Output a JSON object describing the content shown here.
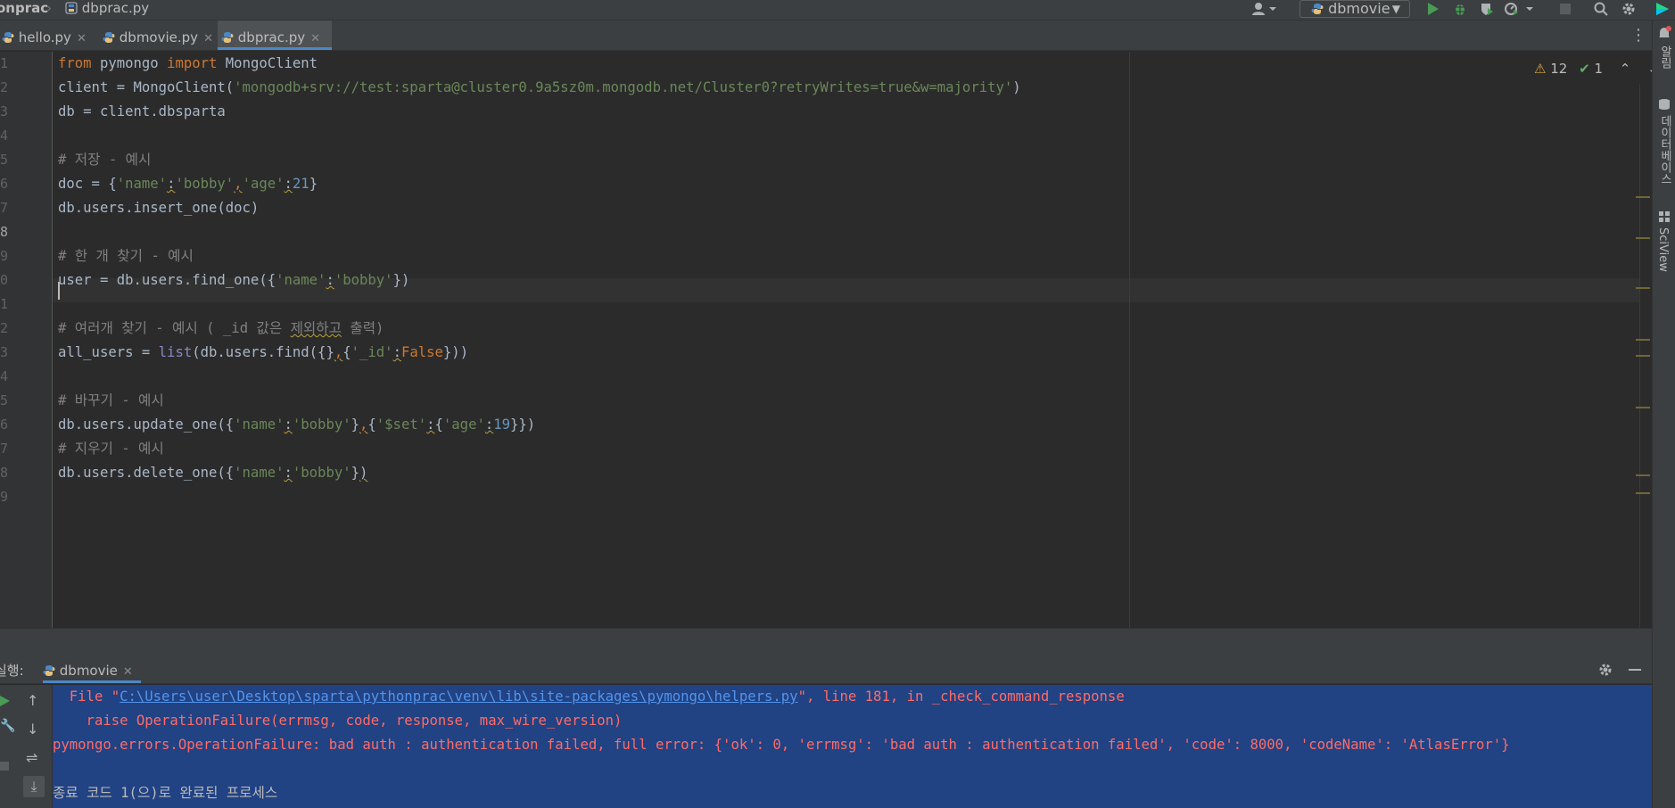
{
  "navbar": {
    "project": "onprac",
    "file": "dbprac.py",
    "run_config": "dbmovie"
  },
  "tabs": [
    {
      "label": "hello.py",
      "active": false
    },
    {
      "label": "dbmovie.py",
      "active": false
    },
    {
      "label": "dbprac.py",
      "active": true
    }
  ],
  "inspections": {
    "warnings": "12",
    "ok": "1"
  },
  "gutter": {
    "lines": [
      "1",
      "2",
      "3",
      "4",
      "5",
      "6",
      "7",
      "8",
      "9",
      "0",
      "1",
      "2",
      "3",
      "4",
      "5",
      "6",
      "7",
      "8",
      "9"
    ],
    "current_index": 7
  },
  "code": {
    "l1": {
      "a": "from",
      "b": " pymongo ",
      "c": "import",
      "d": " MongoClient"
    },
    "l2": {
      "a": "client = MongoClient(",
      "b": "'mongodb+srv://test:sparta@cluster0.9a5sz0m.mongodb.net/Cluster0?retryWrites=true&w=majority'",
      "c": ")"
    },
    "l3": "db = client.dbsparta",
    "l5": "# 저장 - 예시",
    "l6": {
      "a": "doc = {",
      "b": "'name'",
      "c": ":",
      "d": "'bobby'",
      "e": ",",
      "f": "'age'",
      "g": ":",
      "h": "21",
      "i": "}"
    },
    "l7": "db.users.insert_one(doc)",
    "l9": "# 한 개 찾기 - 예시",
    "l10": {
      "a": "user = db.users.find_one({",
      "b": "'name'",
      "c": ":",
      "d": "'bobby'",
      "e": "})"
    },
    "l12": {
      "a": "# 여러개 찾기 - 예시 ( _id 값은 ",
      "b": "제외하고",
      "c": " 출력)"
    },
    "l13": {
      "a": "all_users = ",
      "b": "list",
      "c": "(db.users.find({}",
      "d": ",",
      "e": "{",
      "f": "'_id'",
      "g": ":",
      "h": "False",
      "i": "}))"
    },
    "l15": "# 바꾸기 - 예시",
    "l16": {
      "a": "db.users.update_one({",
      "b": "'name'",
      "c": ":",
      "d": "'bobby'",
      "e": "}",
      "f": ",",
      "g": "{",
      "h": "'$set'",
      "i": ":",
      "j": "{",
      "k": "'age'",
      "l": ":",
      "m": "19",
      "n": "}})"
    },
    "l18": "# 지우기 - 예시",
    "l19": {
      "a": "db.users.delete_one({",
      "b": "'name'",
      "c": ":",
      "d": "'bobby'",
      "e": "}",
      "f": ")"
    }
  },
  "side_panels": {
    "database": "데이터베이스",
    "sciview": "SciView",
    "notifications": "알림"
  },
  "run_panel": {
    "label": "실행:",
    "tab": "dbmovie"
  },
  "console": {
    "line1": {
      "a": "  File \"",
      "link": "C:\\Users\\user\\Desktop\\sparta\\pythonprac\\venv\\lib\\site-packages\\pymongo\\helpers.py",
      "b": "\", line 181, in _check_command_response"
    },
    "line2": "    raise OperationFailure(errmsg, code, response, max_wire_version)",
    "line3": "pymongo.errors.OperationFailure: bad auth : authentication failed, full error: {'ok': 0, 'errmsg': 'bad auth : authentication failed', 'code': 8000, 'codeName': 'AtlasError'}",
    "line5": "종료 코드 1(으)로 완료된 프로세스"
  },
  "colors": {
    "accent": "#4a88c7",
    "console_bg": "#214283",
    "error": "#ff6b68",
    "keyword": "#cc7832",
    "string": "#6a8759",
    "number": "#6897bb"
  }
}
